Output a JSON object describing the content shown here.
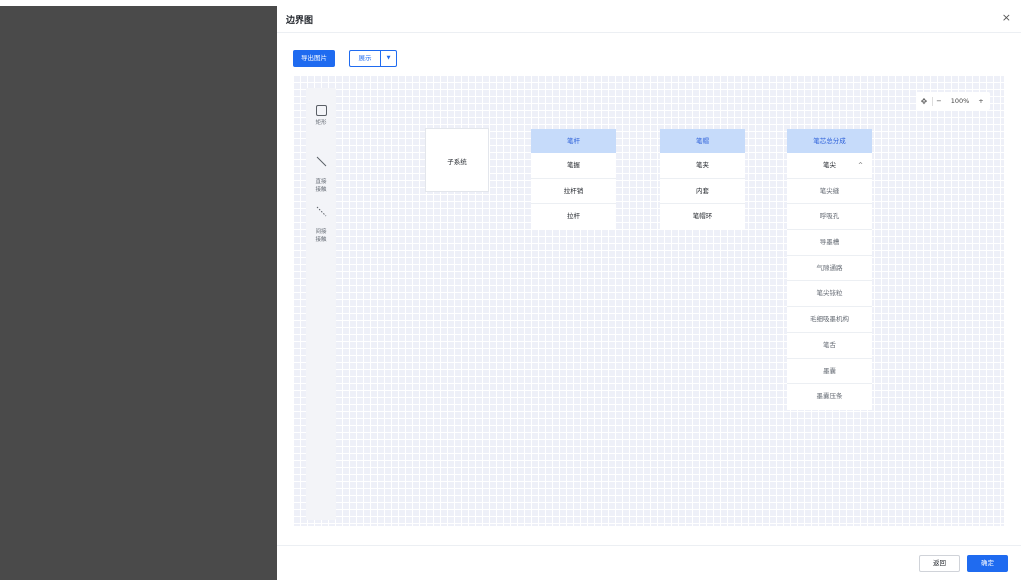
{
  "dialog": {
    "title": "边界图",
    "close_label": "×"
  },
  "toolbar": {
    "export_label": "导出图片",
    "display_label": "展示",
    "dropdown_arrow": "▼"
  },
  "palette": {
    "tools": [
      {
        "label": "矩形",
        "icon": "rectangle-icon"
      },
      {
        "label": "直接\n接触",
        "icon": "direct-line-icon"
      },
      {
        "label": "间接\n接触",
        "icon": "dashed-line-icon"
      }
    ]
  },
  "zoom": {
    "move_icon": "✥",
    "minus": "−",
    "level": "100%",
    "plus": "+"
  },
  "diagram": {
    "subsystem_label": "子系统",
    "columns": [
      {
        "title": "笔杆",
        "items": [
          "笔握",
          "拉杆销",
          "拉杆"
        ]
      },
      {
        "title": "笔帽",
        "items": [
          "笔夹",
          "内套",
          "笔帽环"
        ]
      },
      {
        "title": "笔芯总分成",
        "items": [
          "笔尖"
        ],
        "expanded_caret": "^",
        "sub_items": [
          "笔尖缝",
          "呼吸孔",
          "导墨槽",
          "气隙通路",
          "笔尖铱粒",
          "毛细吸墨机构",
          "笔舌",
          "墨囊",
          "墨囊压条"
        ]
      }
    ]
  },
  "footer": {
    "back_label": "返回",
    "ok_label": "确定"
  },
  "colors": {
    "primary": "#1f6bf0",
    "header_fill": "#c6dbfa",
    "overlay": "#4a4a4a",
    "canvas": "#eef0f8"
  }
}
